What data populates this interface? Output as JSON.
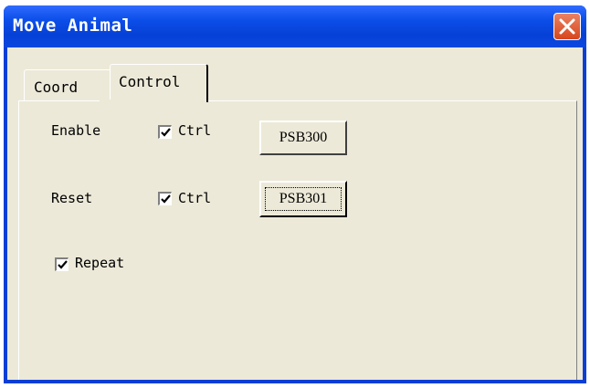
{
  "window": {
    "title": "Move Animal",
    "close_icon": "close-icon"
  },
  "tabs": [
    {
      "label": "Coord",
      "selected": false
    },
    {
      "label": "Control",
      "selected": true
    }
  ],
  "control": {
    "rows": [
      {
        "label": "Enable",
        "checkbox_label": "Ctrl",
        "checked": true,
        "button_label": "PSB300",
        "focused": false
      },
      {
        "label": "Reset",
        "checkbox_label": "Ctrl",
        "checked": true,
        "button_label": "PSB301",
        "focused": true
      }
    ],
    "repeat": {
      "label": "Repeat",
      "checked": true
    }
  },
  "colors": {
    "titlebar": "#0b4ee8",
    "dialog_face": "#ece9d8",
    "close_button": "#d7461c"
  }
}
